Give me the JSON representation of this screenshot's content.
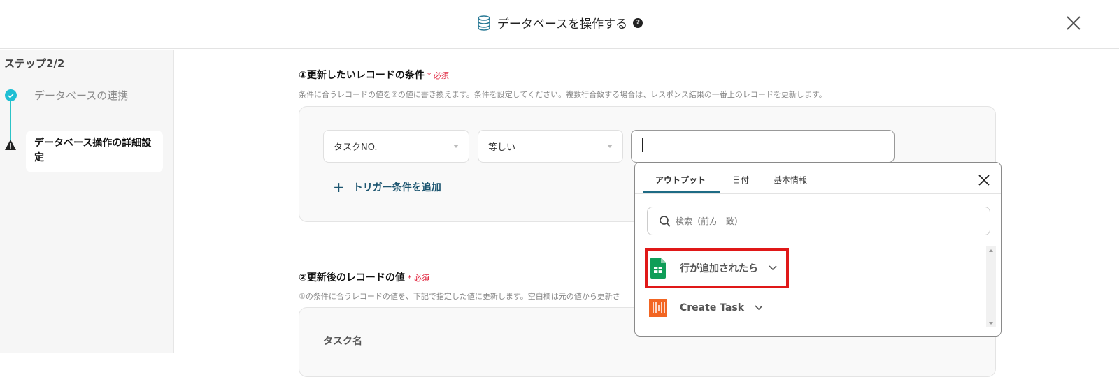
{
  "header": {
    "title": "データベースを操作する",
    "icon": "database-icon",
    "help": "?",
    "close": "close-icon"
  },
  "sidebar": {
    "step": "ステップ2/2",
    "steps": [
      {
        "label": "データベースの連携",
        "status": "done"
      },
      {
        "label": "データベース操作の詳細設定",
        "status": "warning"
      }
    ]
  },
  "section1": {
    "title": "①更新したいレコードの条件",
    "required": "必須",
    "required_mark": "*",
    "desc": "条件に合うレコードの値を②の値に書き換えます。条件を設定してください。複数行合致する場合は、レスポンス結果の一番上のレコードを更新します。",
    "field": "タスクNO.",
    "operator": "等しい",
    "value": "",
    "add_label": "トリガー条件を追加"
  },
  "section2": {
    "title": "②更新後のレコードの値",
    "required": "必須",
    "required_mark": "*",
    "desc": "①の条件に合うレコードの値を、下記で指定した値に更新します。空白欄は元の値から更新さ",
    "field_label": "タスク名"
  },
  "popup": {
    "tabs": [
      "アウトプット",
      "日付",
      "基本情報"
    ],
    "active_tab": 0,
    "search_placeholder": "検索（前方一致）",
    "items": [
      {
        "label": "行が追加されたら",
        "icon": "google-sheets-icon"
      },
      {
        "label": "Create Task",
        "icon": "app-icon"
      }
    ]
  },
  "colors": {
    "accent": "#1e6b85",
    "required": "#e0203a",
    "highlight": "#e01818",
    "sheets": "#0f9d58",
    "app": "#f26522"
  }
}
